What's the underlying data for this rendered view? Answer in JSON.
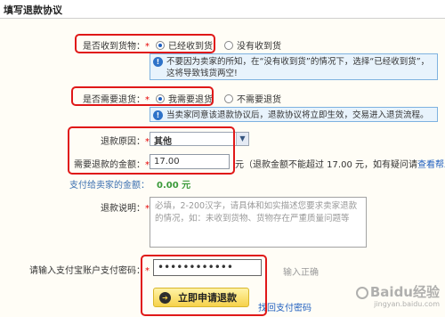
{
  "page": {
    "title": "填写退款协议"
  },
  "received": {
    "label": "是否收到货物：",
    "required_mark": "*",
    "options": [
      "已经收到货",
      "没有收到货"
    ],
    "selected": 0,
    "notice": "不要因为卖家的所知，在“没有收到货”的情况下，选择“已经收到货”，这将导致钱货两空!"
  },
  "return_goods": {
    "label": "是否需要退货：",
    "required_mark": "*",
    "options": [
      "我需要退货",
      "不需要退货"
    ],
    "selected": 0,
    "notice": "当卖家同意该退款协议后，退款协议将立即生效，交易进入退货流程。"
  },
  "reason": {
    "label": "退款原因：",
    "required_mark": "*",
    "value": "其他"
  },
  "refund_amount": {
    "label": "需要退款的金额：",
    "required_mark": "*",
    "value": "17.00",
    "note_prefix": "元（退款金额不能超过 17.00 元，如有疑问请",
    "help_link": "查看帮助",
    "note_suffix": "）"
  },
  "seller_amount": {
    "label": "支付给卖家的金额：",
    "value": "0.00 元"
  },
  "description": {
    "label": "退款说明：",
    "required_mark": "*",
    "placeholder": "必填，2-200汉字，请具体和如实描述您要求卖家退款的情况，如：未收到货物、货物存在严重质量问题等"
  },
  "password": {
    "label": "请输入支付宝账户支付密码：",
    "required_mark": "*",
    "value": "••••••••••••",
    "hint": "输入正确"
  },
  "submit": {
    "label": "立即申请退款"
  },
  "find_password": {
    "label": "找回支付密码"
  },
  "watermark": {
    "text": "Baidu经验",
    "sub": "jingyan.baidu.com"
  },
  "colors": {
    "highlight": "#e01818",
    "required": "#e60000",
    "link": "#1f5fbf",
    "amount": "#3a9a3a"
  }
}
